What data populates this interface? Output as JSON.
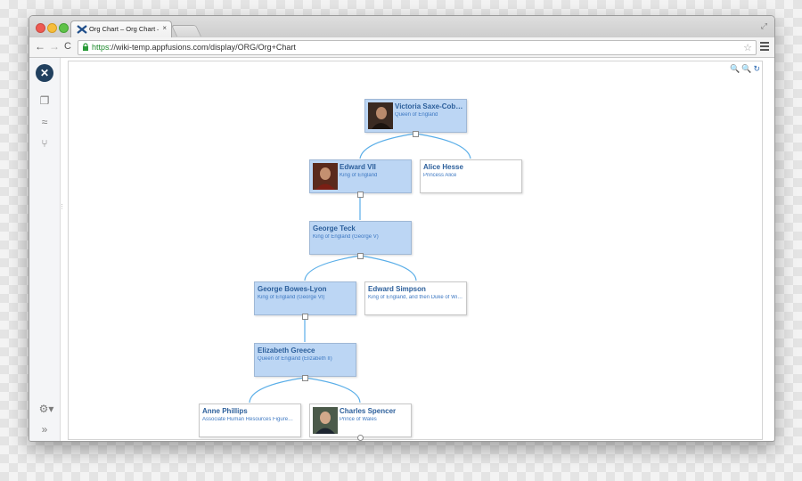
{
  "browser": {
    "tab_title": "Org Chart – Org Chart – C",
    "tab_close": "×",
    "url_scheme": "https",
    "url_rest": "://wiki-temp.appfusions.com/display/ORG/Org+Chart"
  },
  "sidebar": {
    "logo": "✕",
    "settings_label": "⚙▾",
    "expand_label": "»"
  },
  "org_chart": {
    "zoom_in": "🔍",
    "zoom_out": "🔍",
    "reset": "↻",
    "nodes": [
      {
        "name": "Victoria Saxe-Cob…",
        "title": "Queen of England",
        "photo": true,
        "selected": true
      },
      {
        "name": "Edward VII",
        "title": "King of England",
        "photo": true,
        "selected": true
      },
      {
        "name": "Alice Hesse",
        "title": "Princess Alice",
        "photo": false,
        "selected": false
      },
      {
        "name": "George Teck",
        "title": "King of England (George V)",
        "photo": false,
        "selected": true
      },
      {
        "name": "George Bowes-Lyon",
        "title": "King of England (George VI)",
        "photo": false,
        "selected": true
      },
      {
        "name": "Edward Simpson",
        "title": "King of England, and then Duke of Wi…",
        "photo": false,
        "selected": false
      },
      {
        "name": "Elizabeth Greece",
        "title": "Queen of England (Elizabeth II)",
        "photo": false,
        "selected": true
      },
      {
        "name": "Anne Phillips",
        "title": "Associate Human Resources Figure…",
        "photo": false,
        "selected": false
      },
      {
        "name": "Charles Spencer",
        "title": "Prince of Wales",
        "photo": true,
        "selected": false
      }
    ]
  },
  "colors": {
    "selected_fill": "#bcd6f4",
    "link_blue": "#2c5f9b",
    "connector": "#5aaee8"
  }
}
